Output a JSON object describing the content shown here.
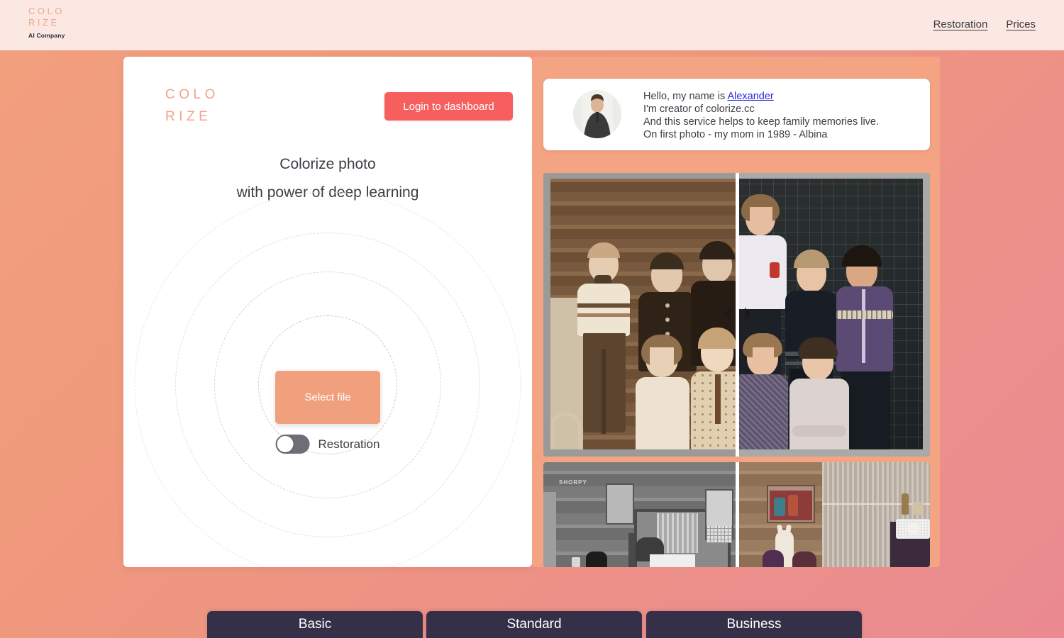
{
  "header": {
    "brand_line1": "COLO",
    "brand_line2": "RIZE",
    "brand_sub": "AI Company",
    "nav": [
      {
        "label": "Restoration"
      },
      {
        "label": "Prices"
      }
    ]
  },
  "left_card": {
    "logo_line1": "COLO",
    "logo_line2": "RIZE",
    "login_button": "Login to dashboard",
    "headline_line1": "Colorize photo",
    "headline_line2": "with power of deep learning",
    "select_file_button": "Select file",
    "restoration_toggle_label": "Restoration",
    "restoration_toggle_state": "off"
  },
  "testimonial": {
    "line1_prefix": "Hello, my name is ",
    "line1_link": "Alexander",
    "line2": "I'm creator of colorize.cc",
    "line3": "And this service helps to keep family memories live.",
    "line4": "On first photo - my mom in 1989 -  Albina",
    "avatar_alt": "portrait-photo-of-alexander"
  },
  "comparisons": [
    {
      "name": "class-photo-1989",
      "left_caption": "original-sepia-class-photo",
      "right_caption": "colorized-class-photo",
      "divider_position_percent": 50
    },
    {
      "name": "shorpy-interior-photo",
      "left_caption": "original-black-and-white-room",
      "right_caption": "colorized-room",
      "watermark": "SHORPY",
      "divider_position_percent": 50
    }
  ],
  "pricing": {
    "plans": [
      {
        "title": "Basic"
      },
      {
        "title": "Standard"
      },
      {
        "title": "Business"
      }
    ]
  },
  "colors": {
    "accent_coral": "#f0a07c",
    "login_red": "#f75f5f",
    "brand_salmon": "#f0a38c",
    "header_bg": "#fbe8e2",
    "panel_orange": "#f4a483",
    "pricing_dark": "#353048",
    "link_blue": "#2626e0"
  }
}
